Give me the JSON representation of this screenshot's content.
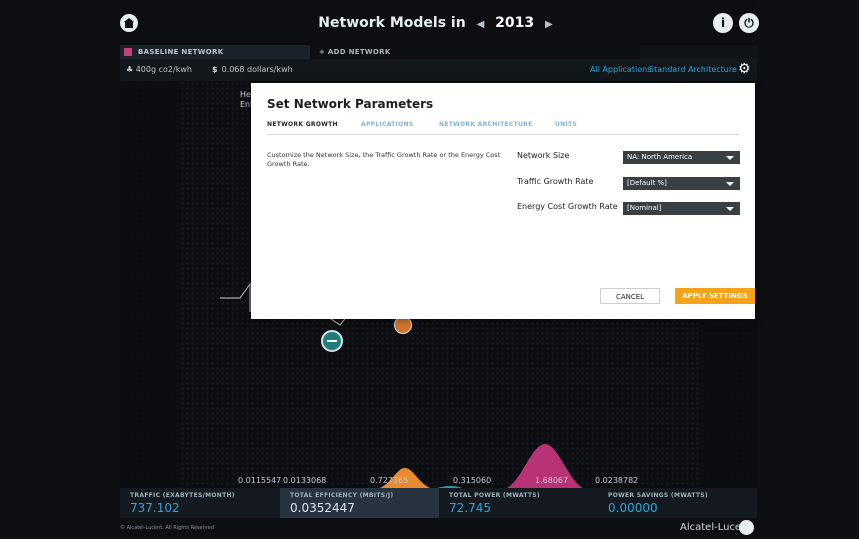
{
  "header": {
    "title_prefix": "Network Models in",
    "year": "2013",
    "prev_arrow": "◀",
    "next_arrow": "▶",
    "info_icon": "info-icon",
    "power_icon": "power-icon"
  },
  "tabs": {
    "baseline_label": "BASELINE NETWORK",
    "add_label": "+ ADD NETWORK",
    "baseline_color": "#c5427d"
  },
  "subbar": {
    "co2": "400g co2/kwh",
    "money_symbol": "$",
    "money": "0.068 dollars/kwh",
    "apps_link": "All Applications",
    "arch_link": "Standard Architecture"
  },
  "map_overlay": {
    "line1": "He",
    "line2": "Ent"
  },
  "modal": {
    "title": "Set Network Parameters",
    "tabs": [
      "NETWORK GROWTH",
      "APPLICATIONS",
      "NETWORK ARCHITECTURE",
      "UNITS"
    ],
    "description": "Customize the Network Size, the Traffic Growth Rate or the Energy Cost Growth Rate.",
    "fields": [
      {
        "label": "Network Size",
        "value": "NA: North America"
      },
      {
        "label": "Traffic Growth Rate",
        "value": "[Default %]"
      },
      {
        "label": "Energy Cost Growth Rate",
        "value": "[Nominal]"
      }
    ],
    "cancel_label": "CANCEL",
    "apply_label": "APPLY SETTINGS",
    "apply_color": "#f5a31a"
  },
  "bottom_values": [
    "0.0115547",
    "0.0133068",
    "0.727365",
    "0.315060",
    "1.68067",
    "0.0238782"
  ],
  "stats": [
    {
      "label": "TRAFFIC (EXABYTES/MONTH)",
      "value": "737.102"
    },
    {
      "label": "TOTAL EFFICIENCY (MBITS/J)",
      "value": "0.0352447"
    },
    {
      "label": "TOTAL POWER (MWATTS)",
      "value": "72.745"
    },
    {
      "label": "POWER SAVINGS (MWATTS)",
      "value": "0.00000"
    }
  ],
  "footer": {
    "copyright": "© Alcatel-Lucent. All Rights Reserved",
    "brand": "Alcatel-Lucent"
  }
}
